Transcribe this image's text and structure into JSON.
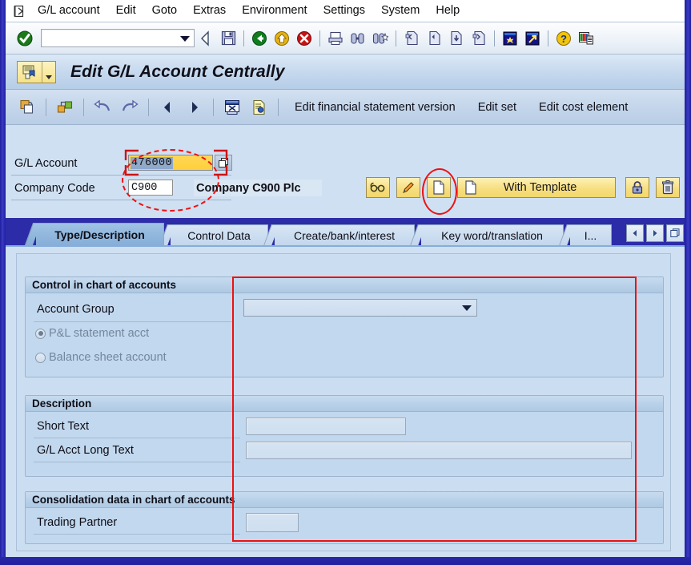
{
  "window": {
    "title": "Edit G/L Account Centrally"
  },
  "menubar": {
    "system_icon": "system-menu-icon",
    "items": [
      {
        "label": "G/L account",
        "accel": "L"
      },
      {
        "label": "Edit",
        "accel": "E"
      },
      {
        "label": "Goto",
        "accel": "G"
      },
      {
        "label": "Extras",
        "accel": "a"
      },
      {
        "label": "Environment",
        "accel": "v"
      },
      {
        "label": "Settings",
        "accel": "S"
      },
      {
        "label": "System",
        "accel": "y"
      },
      {
        "label": "Help",
        "accel": "H"
      }
    ]
  },
  "toolbar": {
    "ok_icon": "enter-ok-icon",
    "command_value": "",
    "command_placeholder": "",
    "dropdown_icon": "chevron-down-icon",
    "icons": [
      "back-arrow-icon",
      "save-icon",
      "back-green-icon",
      "exit-yellow-icon",
      "cancel-red-icon",
      "print-icon",
      "find-icon",
      "find-next-icon",
      "first-page-icon",
      "previous-page-icon",
      "next-page-icon",
      "last-page-icon",
      "create-session-icon",
      "create-shortcut-icon",
      "help-icon",
      "customize-layout-icon"
    ]
  },
  "apptoolbar": {
    "icons": [
      "copy-icon",
      "other-account-icon",
      "undo-icon",
      "redo-icon",
      "previous-icon",
      "next-icon",
      "sample-account-icon",
      "display-document-icon"
    ],
    "links": [
      "Edit financial statement version",
      "Edit set",
      "Edit cost element"
    ]
  },
  "header": {
    "gl_account_label": "G/L Account",
    "gl_account_value": "476000",
    "matchcode_icon": "matchcode-search-icon",
    "company_code_label": "Company Code",
    "company_code_value": "C900",
    "company_name": "Company C900 Plc",
    "buttons": [
      {
        "name": "display-changes-button",
        "icon": "glasses-icon",
        "label": ""
      },
      {
        "name": "change-button",
        "icon": "pencil-icon",
        "label": ""
      },
      {
        "name": "create-button",
        "icon": "blank-page-icon",
        "label": ""
      },
      {
        "name": "with-template-button",
        "icon": "page-icon",
        "label": "With Template"
      },
      {
        "name": "block-button",
        "icon": "lock-icon",
        "label": ""
      },
      {
        "name": "delete-button",
        "icon": "trash-icon",
        "label": ""
      }
    ]
  },
  "tabs": {
    "items": [
      {
        "label": "Type/Description",
        "active": true
      },
      {
        "label": "Control Data",
        "active": false
      },
      {
        "label": "Create/bank/interest",
        "active": false
      },
      {
        "label": "Key word/translation",
        "active": false
      },
      {
        "label": "I...",
        "active": false
      }
    ],
    "nav_prev_icon": "tab-scroll-left-icon",
    "nav_next_icon": "tab-scroll-right-icon",
    "nav_list_icon": "tab-list-icon"
  },
  "groups": {
    "control": {
      "title": "Control in chart of accounts",
      "account_group_label": "Account Group",
      "account_group_value": "",
      "dropdown_icon": "chevron-down-icon",
      "radio_pl": "P&L statement acct",
      "radio_bs": "Balance sheet account",
      "radio_selected": "pl"
    },
    "description": {
      "title": "Description",
      "short_text_label": "Short Text",
      "short_text_value": "",
      "long_text_label": "G/L Acct Long Text",
      "long_text_value": ""
    },
    "consolidation": {
      "title": "Consolidation data in chart of accounts",
      "trading_partner_label": "Trading Partner",
      "trading_partner_value": ""
    }
  },
  "annotations": {
    "gl_account_ellipse": "highlight-gl-account-field",
    "create_button_ellipse": "highlight-create-button",
    "panel_rectangle": "highlight-empty-fields-region",
    "color": "#ee1111"
  },
  "colors": {
    "window_border": "#2c2ca8",
    "menu_bg": "#ffffff",
    "header_bg": "#cfe0f2",
    "field_yellow": "#ffcf3b",
    "button_yellow": "#f7df81",
    "active_tab": "#86aed8",
    "annotation_red": "#ee1111"
  }
}
